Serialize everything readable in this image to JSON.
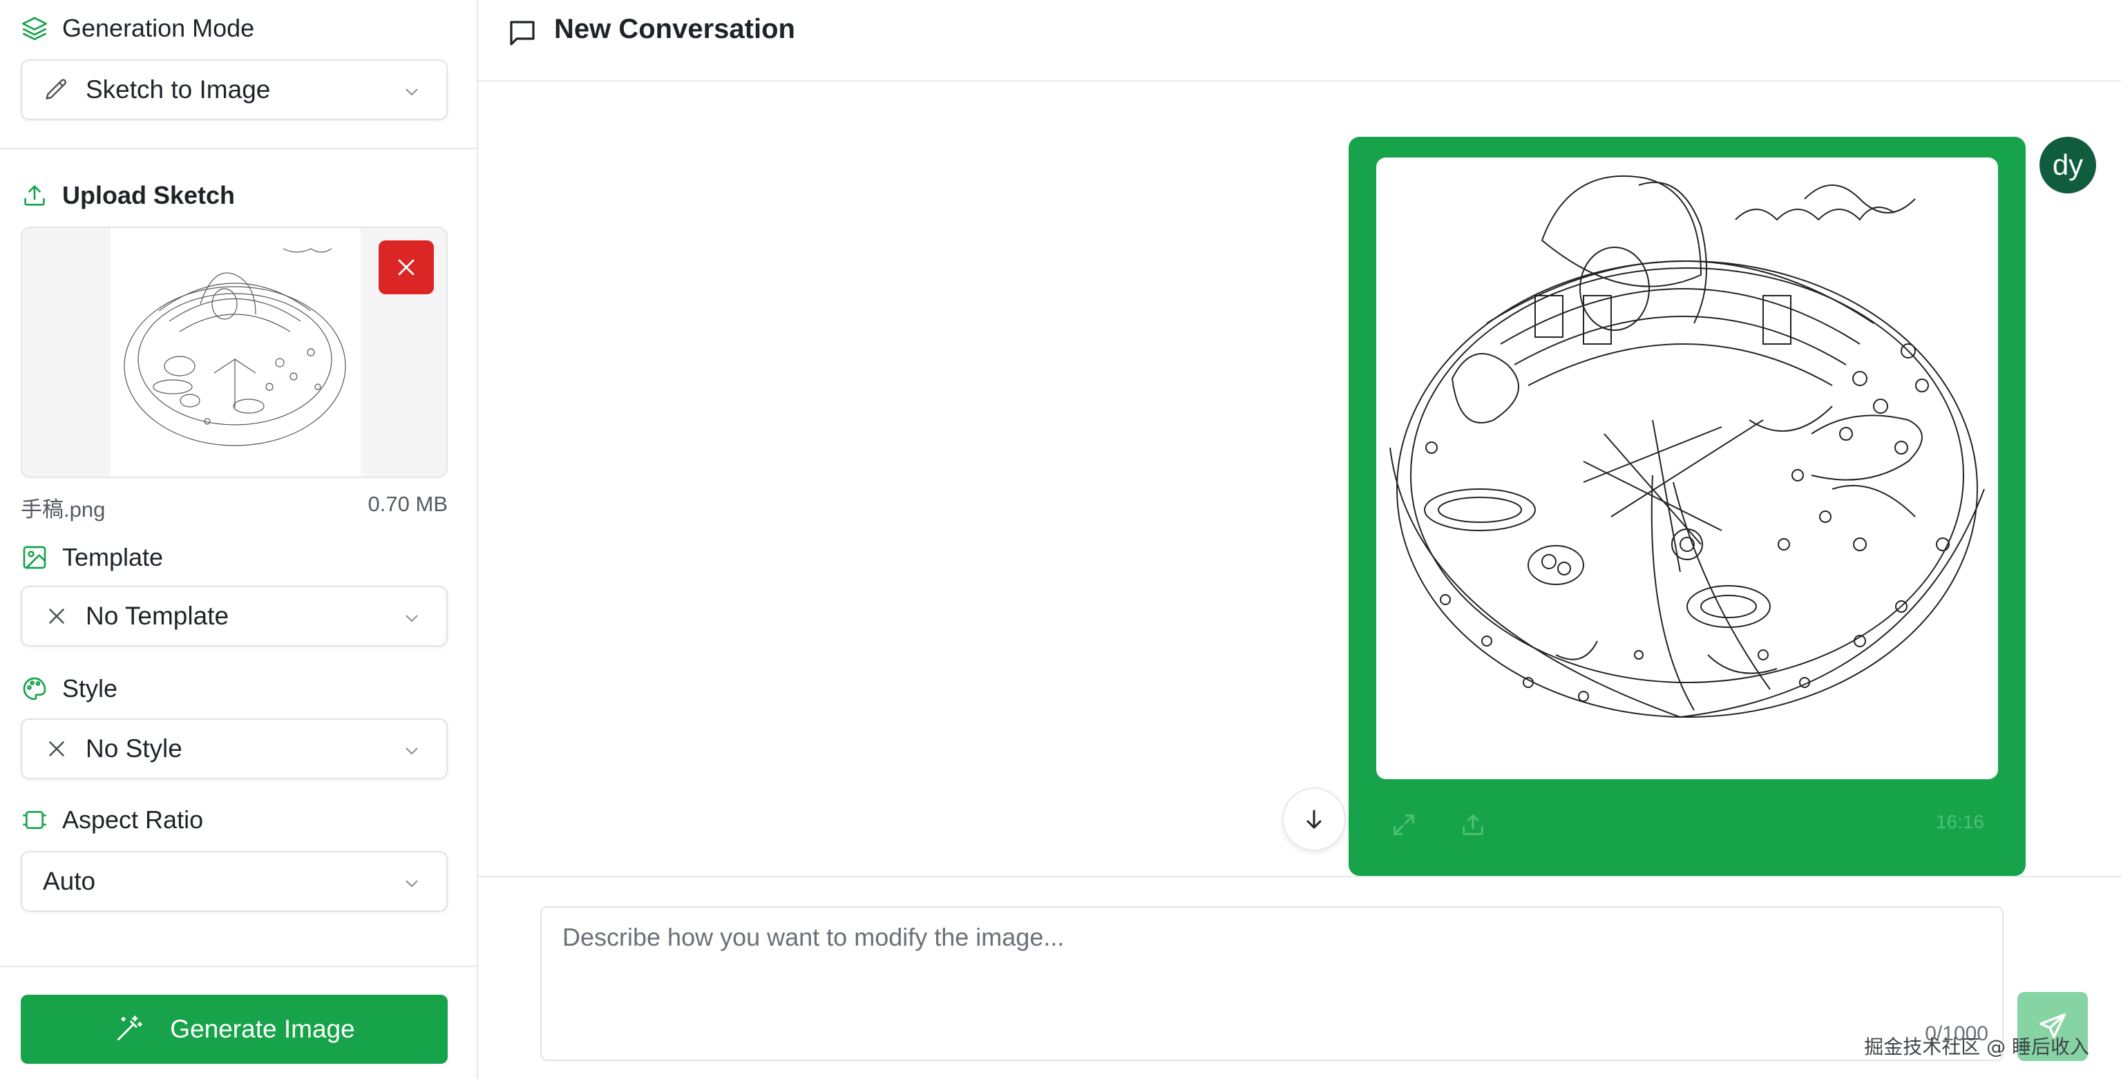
{
  "sidebar": {
    "generation_mode": {
      "title": "Generation Mode",
      "value": "Sketch to Image",
      "icon": "layers-icon"
    },
    "upload": {
      "title": "Upload Sketch",
      "file_name": "手稿.png",
      "file_size": "0.70 MB",
      "icon": "upload-icon"
    },
    "template": {
      "title": "Template",
      "value": "No Template",
      "icon": "image-icon"
    },
    "style": {
      "title": "Style",
      "value": "No Style",
      "icon": "palette-icon"
    },
    "aspect_ratio": {
      "title": "Aspect Ratio",
      "value": "Auto",
      "icon": "crop-icon"
    },
    "generate_label": "Generate Image"
  },
  "header": {
    "title": "New Conversation",
    "icon": "message-square-icon"
  },
  "message": {
    "avatar": "dy",
    "ratio_label": "16:16"
  },
  "composer": {
    "placeholder": "Describe how you want to modify the image...",
    "counter": "0/1000"
  },
  "watermark": "掘金技术社区 @ 睡后收入",
  "colors": {
    "accent": "#16a34a",
    "danger": "#dc2626",
    "avatar": "#0f5c3e",
    "send_disabled": "#86d3a3"
  }
}
